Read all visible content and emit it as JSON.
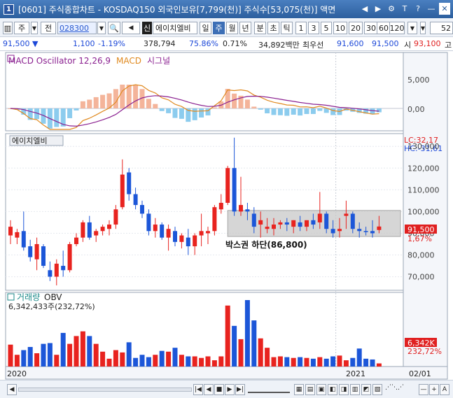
{
  "window": {
    "number": "1",
    "title": "[0601] 주식종합차트 - KOSDAQ150 외국인보유[7,799(천)] 주식수[53,075(천)] 액면",
    "buttons": [
      "◀",
      "▶",
      "⚙",
      "T",
      "?",
      "—",
      "✕"
    ]
  },
  "toolbar": {
    "market": "주",
    "type_label": "전",
    "code": "028300",
    "sound": "◀",
    "credit_tag": "신",
    "stock_name": "에이치엘비",
    "periods": [
      "일",
      "주",
      "월",
      "년",
      "분",
      "초",
      "틱"
    ],
    "selected_period": "주",
    "intervals": [
      "1",
      "3",
      "5",
      "10",
      "20",
      "30",
      "60",
      "120"
    ],
    "count": "52"
  },
  "info": {
    "price": "91,500",
    "change": "1,100",
    "change_pct": "-1.19%",
    "volume": "378,794",
    "vol_ratio": "75.86%",
    "turnover": "0.71%",
    "amount": "34,892백만",
    "best_bid_label": "최우선",
    "ask": "91,600",
    "bid": "91,500",
    "open_label": "시",
    "open": "93,100",
    "high_label": "고"
  },
  "panels": {
    "macd": {
      "label": "MACD Oscillator 12,26,9",
      "macd_label": "MACD",
      "signal_label": "시그널",
      "ticks": [
        "5,000",
        "0,00"
      ]
    },
    "price": {
      "stock_label": "에이치엘비",
      "lc": "LC:32,17",
      "hc": "HC:-31,61",
      "ticks": [
        "130,000",
        "120,000",
        "110,000",
        "100,000",
        "90,000",
        "80,000",
        "70,000"
      ],
      "current_price": "91,500",
      "current_pct": "1,67%",
      "annotation": "박스권 하단(86,800)"
    },
    "volume": {
      "label_volume": "거래량",
      "label_obv": "OBV",
      "value": "6,342,433주(232,72%)",
      "badge_value": "6,342K",
      "badge_pct": "232,72%"
    },
    "xaxis": {
      "labels": [
        "2020",
        "2021",
        "02/01"
      ]
    }
  },
  "scroller": {
    "buttons": [
      "◀",
      "|◀",
      "◀",
      "■",
      "▶",
      "▶|",
      "—",
      "+",
      "A"
    ]
  },
  "colors": {
    "up": "#e8231f",
    "down": "#1c56d8",
    "macd_line": "#e08a20",
    "signal_line": "#8a2090",
    "hist_pos": "#f4b49a",
    "hist_neg": "#8cccee",
    "box": "#c8c8c8"
  },
  "chart_data": {
    "type": "candlestick",
    "candles": [
      {
        "o": 89000,
        "h": 96000,
        "l": 85000,
        "c": 93000
      },
      {
        "o": 88000,
        "h": 92000,
        "l": 85000,
        "c": 90500
      },
      {
        "o": 91000,
        "h": 100000,
        "l": 82000,
        "c": 83500
      },
      {
        "o": 84000,
        "h": 87000,
        "l": 77000,
        "c": 79000
      },
      {
        "o": 78000,
        "h": 88000,
        "l": 73000,
        "c": 85000
      },
      {
        "o": 84000,
        "h": 85000,
        "l": 74000,
        "c": 75000
      },
      {
        "o": 73000,
        "h": 77000,
        "l": 68000,
        "c": 70000
      },
      {
        "o": 70000,
        "h": 78000,
        "l": 66000,
        "c": 76000
      },
      {
        "o": 75000,
        "h": 82000,
        "l": 70000,
        "c": 73000
      },
      {
        "o": 73000,
        "h": 86000,
        "l": 72000,
        "c": 85000
      },
      {
        "o": 85000,
        "h": 90000,
        "l": 84000,
        "c": 88000
      },
      {
        "o": 88000,
        "h": 96000,
        "l": 86000,
        "c": 95000
      },
      {
        "o": 95000,
        "h": 98000,
        "l": 87000,
        "c": 88000
      },
      {
        "o": 89000,
        "h": 92000,
        "l": 86000,
        "c": 91000
      },
      {
        "o": 91000,
        "h": 94000,
        "l": 89000,
        "c": 93000
      },
      {
        "o": 92000,
        "h": 96000,
        "l": 89000,
        "c": 94000
      },
      {
        "o": 94000,
        "h": 103000,
        "l": 92000,
        "c": 101000
      },
      {
        "o": 102000,
        "h": 124000,
        "l": 101000,
        "c": 117000
      },
      {
        "o": 118000,
        "h": 120000,
        "l": 105000,
        "c": 108000
      },
      {
        "o": 108000,
        "h": 111000,
        "l": 101000,
        "c": 103000
      },
      {
        "o": 103000,
        "h": 105000,
        "l": 97000,
        "c": 99000
      },
      {
        "o": 99000,
        "h": 101000,
        "l": 89000,
        "c": 91000
      },
      {
        "o": 91000,
        "h": 97000,
        "l": 88000,
        "c": 94000
      },
      {
        "o": 94000,
        "h": 95000,
        "l": 87000,
        "c": 88000
      },
      {
        "o": 88000,
        "h": 94000,
        "l": 82000,
        "c": 92000
      },
      {
        "o": 91000,
        "h": 93000,
        "l": 84000,
        "c": 86000
      },
      {
        "o": 86000,
        "h": 90000,
        "l": 83000,
        "c": 89000
      },
      {
        "o": 88000,
        "h": 92000,
        "l": 80000,
        "c": 84000
      },
      {
        "o": 84000,
        "h": 90000,
        "l": 80000,
        "c": 89000
      },
      {
        "o": 89000,
        "h": 99000,
        "l": 84000,
        "c": 91000
      },
      {
        "o": 90000,
        "h": 93000,
        "l": 85000,
        "c": 91000
      },
      {
        "o": 91000,
        "h": 103000,
        "l": 89000,
        "c": 102000
      },
      {
        "o": 101000,
        "h": 108000,
        "l": 99000,
        "c": 104000
      },
      {
        "o": 104000,
        "h": 121000,
        "l": 103000,
        "c": 120000
      },
      {
        "o": 120000,
        "h": 134000,
        "l": 98000,
        "c": 100000
      },
      {
        "o": 100000,
        "h": 116000,
        "l": 98000,
        "c": 103000
      },
      {
        "o": 101000,
        "h": 104000,
        "l": 96000,
        "c": 100000
      },
      {
        "o": 99000,
        "h": 102000,
        "l": 90000,
        "c": 93000
      },
      {
        "o": 94000,
        "h": 100000,
        "l": 88000,
        "c": 96000
      },
      {
        "o": 92000,
        "h": 97000,
        "l": 90000,
        "c": 93000
      },
      {
        "o": 92000,
        "h": 97000,
        "l": 89000,
        "c": 94000
      },
      {
        "o": 94000,
        "h": 96000,
        "l": 92000,
        "c": 95000
      },
      {
        "o": 95000,
        "h": 97000,
        "l": 91000,
        "c": 94000
      },
      {
        "o": 93000,
        "h": 96000,
        "l": 90000,
        "c": 96000
      },
      {
        "o": 95000,
        "h": 98000,
        "l": 91000,
        "c": 93000
      },
      {
        "o": 93000,
        "h": 96000,
        "l": 91000,
        "c": 96000
      },
      {
        "o": 96000,
        "h": 99000,
        "l": 92000,
        "c": 94000
      },
      {
        "o": 95000,
        "h": 109000,
        "l": 92000,
        "c": 99000
      },
      {
        "o": 99000,
        "h": 100000,
        "l": 90000,
        "c": 92000
      },
      {
        "o": 92000,
        "h": 96000,
        "l": 88000,
        "c": 90000
      },
      {
        "o": 91000,
        "h": 97000,
        "l": 88000,
        "c": 92000
      },
      {
        "o": 98000,
        "h": 105000,
        "l": 92000,
        "c": 99000
      },
      {
        "o": 99000,
        "h": 100000,
        "l": 90000,
        "c": 92000
      },
      {
        "o": 92000,
        "h": 95000,
        "l": 88000,
        "c": 91000
      },
      {
        "o": 91000,
        "h": 93000,
        "l": 89000,
        "c": 90500
      },
      {
        "o": 91000,
        "h": 96000,
        "l": 88000,
        "c": 90000
      },
      {
        "o": 91500,
        "h": 98000,
        "l": 90000,
        "c": 93100
      }
    ],
    "volume": [
      2.8,
      1.5,
      2.1,
      2.5,
      1.7,
      2.9,
      3.0,
      1.5,
      4.3,
      2.9,
      3.9,
      4.5,
      3.9,
      2.9,
      1.9,
      1.0,
      2.1,
      1.8,
      3.1,
      1.1,
      1.5,
      1.2,
      1.5,
      2.0,
      1.9,
      2.4,
      1.5,
      1.3,
      1.3,
      1.1,
      1.3,
      0.8,
      1.3,
      7.8,
      5.2,
      3.5,
      8.5,
      5.9,
      3.6,
      2.4,
      1.2,
      1.3,
      1.2,
      1.1,
      1.2,
      1.1,
      1.0,
      1.2,
      1.0,
      1.3,
      1.4,
      0.8,
      1.1,
      2.3,
      1.0,
      0.9,
      0.4,
      0.6,
      2.3
    ],
    "box_range": [
      88500,
      100500
    ],
    "xlabels": [
      "2020",
      "2021",
      "02/01"
    ]
  }
}
